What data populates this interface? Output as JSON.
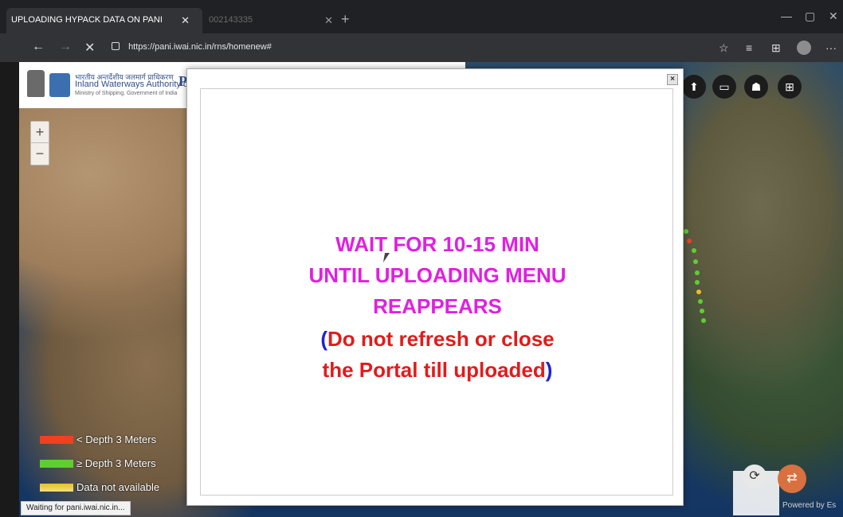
{
  "browser": {
    "active_tab_title": "UPLOADING HYPACK DATA ON PANI",
    "inactive_tab_title": "002143335",
    "url": "https://pani.iwai.nic.in/rns/homenew#",
    "status_text": "Waiting for pani.iwai.nic.in..."
  },
  "header": {
    "org_hindi": "भारतीय अन्तर्देशीय जलमार्ग प्राधिकरण",
    "org_name": "Inland Waterways Authority of India",
    "org_sub": "Ministry of Shipping, Government of India",
    "portal_initial": "P"
  },
  "map": {
    "zoom_in": "+",
    "zoom_out": "−",
    "legend": [
      {
        "label": "< Depth 3 Meters",
        "color": "#f04020"
      },
      {
        "label": "≥ Depth 3 Meters",
        "color": "#5fcf2f"
      },
      {
        "label": "Data not available",
        "color": "#e8c020"
      }
    ],
    "attribution": "Powered by Es"
  },
  "modal": {
    "close_label": "×",
    "line1": "WAIT FOR 10-15 MIN",
    "line2": "UNTIL UPLOADING MENU",
    "line3": "REAPPEARS",
    "paren_open": "(",
    "line4_text": "Do not refresh or close",
    "line5_text": "the Portal till uploaded",
    "paren_close": ")"
  },
  "colors": {
    "magenta": "#e020e0",
    "red": "#e21b1b",
    "blue": "#2222cc"
  }
}
